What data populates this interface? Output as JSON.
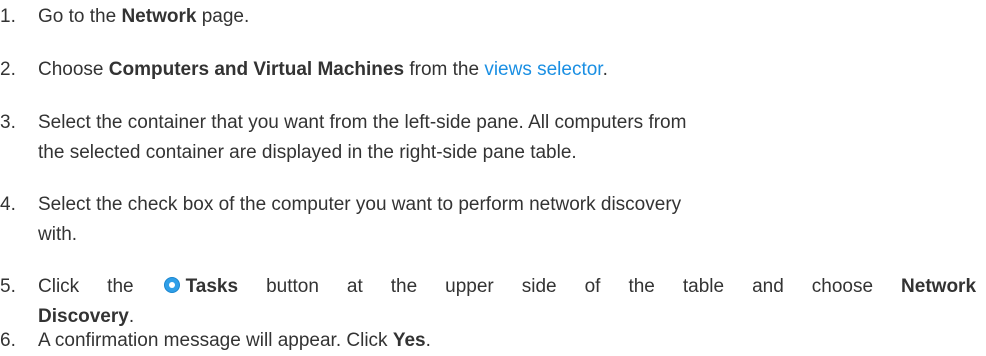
{
  "steps": [
    {
      "num": "1.",
      "t1": "Go to the ",
      "b1": "Network",
      "t2": " page."
    },
    {
      "num": "2.",
      "t1": "Choose ",
      "b1": "Computers and Virtual Machines",
      "t2": " from the ",
      "link": "views selector",
      "t3": "."
    },
    {
      "num": "3.",
      "line1": "Select the container that you want from the left-side pane. All computers from",
      "line2": "the selected container are displayed in the right-side pane table."
    },
    {
      "num": "4.",
      "line1": "Select the check box of the computer you want to perform network discovery",
      "line2": "with."
    },
    {
      "num": "5.",
      "t1": "Click the ",
      "icon": "tasks-icon",
      "b1": "Tasks",
      "t2": " button at the upper side of the table and choose ",
      "b2": "Network",
      "b3": "Discovery",
      "t3": "."
    },
    {
      "num": "6.",
      "t1": "A confirmation message will appear. Click ",
      "b1": "Yes",
      "t2": "."
    }
  ]
}
